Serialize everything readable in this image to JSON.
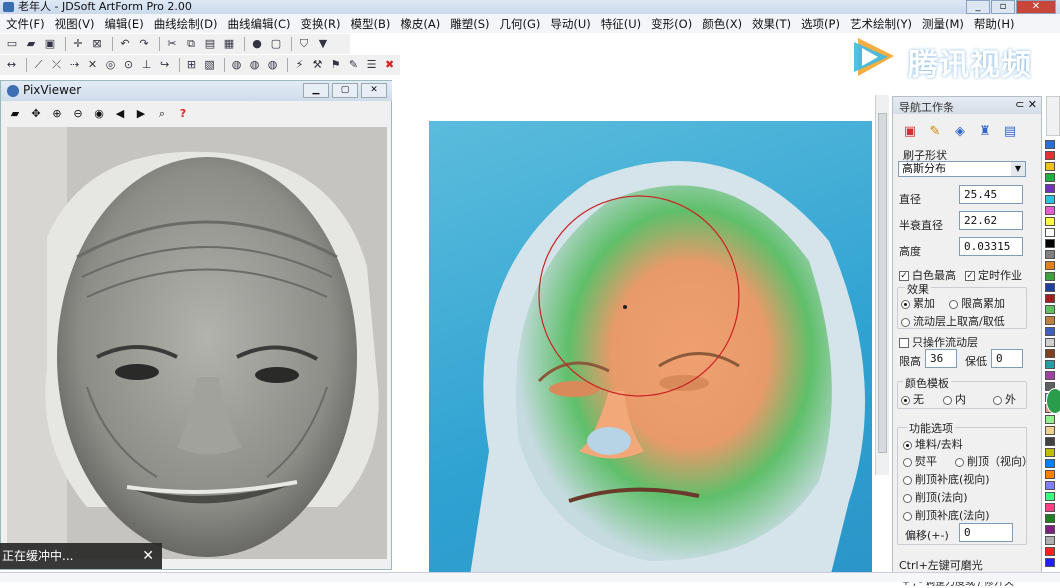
{
  "window": {
    "title": "老年人 - JDSoft ArtForm Pro 2.00"
  },
  "menu": [
    "文件(F)",
    "视图(V)",
    "编辑(E)",
    "曲线绘制(D)",
    "曲线编辑(C)",
    "变换(R)",
    "模型(B)",
    "橡皮(A)",
    "雕塑(S)",
    "几何(G)",
    "导动(U)",
    "特征(U)",
    "变形(O)",
    "颜色(X)",
    "效果(T)",
    "选项(P)",
    "艺术绘制(Y)",
    "测量(M)",
    "帮助(H)"
  ],
  "watermark": {
    "text": "腾讯视频"
  },
  "pixviewer": {
    "title": "PixViewer"
  },
  "panel": {
    "title": "导航工作条",
    "brush_shape_label": "刷子形状",
    "brush_shape_value": "高斯分布",
    "diameter_label": "直径",
    "diameter_value": "25.45",
    "half_decay_label": "半衰直径",
    "half_decay_value": "22.62",
    "height_label": "高度",
    "height_value": "0.03315",
    "white_max_label": "白色最高",
    "timed_label": "定时作业",
    "effect_label": "效果",
    "effect_accumulate": "累加",
    "effect_limit": "限高累加",
    "effect_flow": "流动层上取高/取低",
    "only_flow_label": "只操作流动层",
    "limit_high_label": "限高",
    "limit_high_value": "36",
    "keep_low_label": "保低",
    "keep_low_value": "0",
    "color_template_label": "颜色模板",
    "color_none": "无",
    "color_inner": "内",
    "color_outer": "外",
    "func_label": "功能选项",
    "func_pile": "堆料/去料",
    "func_flatten": "熨平",
    "func_cut_view": "削顶（视向）",
    "func_cut_fill_view": "削顶补底(视向)",
    "func_cut_normal": "削顶(法向)",
    "func_cut_fill_normal": "削顶补底(法向)",
    "offset_label": "偏移(+-)",
    "offset_value": "0",
    "hint1": "Ctrl+左键可磨光",
    "hint2": "'+','-'调整力度或'/'修开关"
  },
  "status": {
    "text": "正在缓冲中..."
  },
  "palette": [
    "#2a6fd6",
    "#e33030",
    "#f0c020",
    "#20b040",
    "#7030c0",
    "#30c0e0",
    "#e060d0",
    "#ffff40",
    "#ffffff",
    "#000000",
    "#808080",
    "#e08020",
    "#40a040",
    "#2040a0",
    "#a02020",
    "#60c060",
    "#c08040",
    "#4060c0",
    "#d0d0d0",
    "#804020",
    "#20a0a0",
    "#a040a0",
    "#606060",
    "#90c0f0",
    "#f09090",
    "#90f090",
    "#f0d090",
    "#404040",
    "#c0c000",
    "#0080ff",
    "#ff8000",
    "#8080ff",
    "#40ff80",
    "#ff4080",
    "#208020",
    "#802080",
    "#b0b0b0",
    "#ff2020",
    "#2020ff"
  ]
}
